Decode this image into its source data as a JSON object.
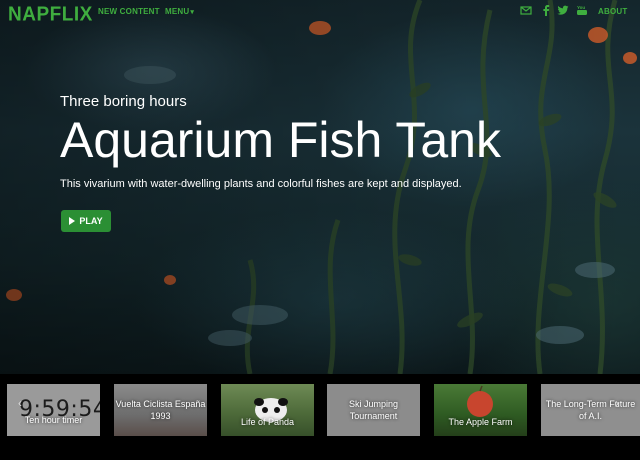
{
  "brand": {
    "logo": "NAPFLIX",
    "accent_color": "#3fae3f"
  },
  "nav": {
    "new_content": "NEW CONTENT",
    "menu": "MENU",
    "about": "ABOUT",
    "icons": [
      "mail-icon",
      "facebook-icon",
      "twitter-icon",
      "youtube-icon"
    ]
  },
  "hero": {
    "kicker": "Three boring hours",
    "title": "Aquarium Fish Tank",
    "description": "This vivarium with water-dwelling plants and colorful fishes are kept and displayed.",
    "play_label": "PLAY",
    "play_color": "#2b8f34"
  },
  "carousel": {
    "items": [
      {
        "label": "Ten hour timer",
        "clock": "9:59:54"
      },
      {
        "label": "Vuelta Ciclista España 1993"
      },
      {
        "label": "Life of Panda"
      },
      {
        "label": "Ski Jumping Tournament"
      },
      {
        "label": "The Apple Farm"
      },
      {
        "label": "The Long-Term Future of A.I."
      }
    ],
    "prev_icon": "chevron-left-icon",
    "next_icon": "chevron-right-icon"
  }
}
